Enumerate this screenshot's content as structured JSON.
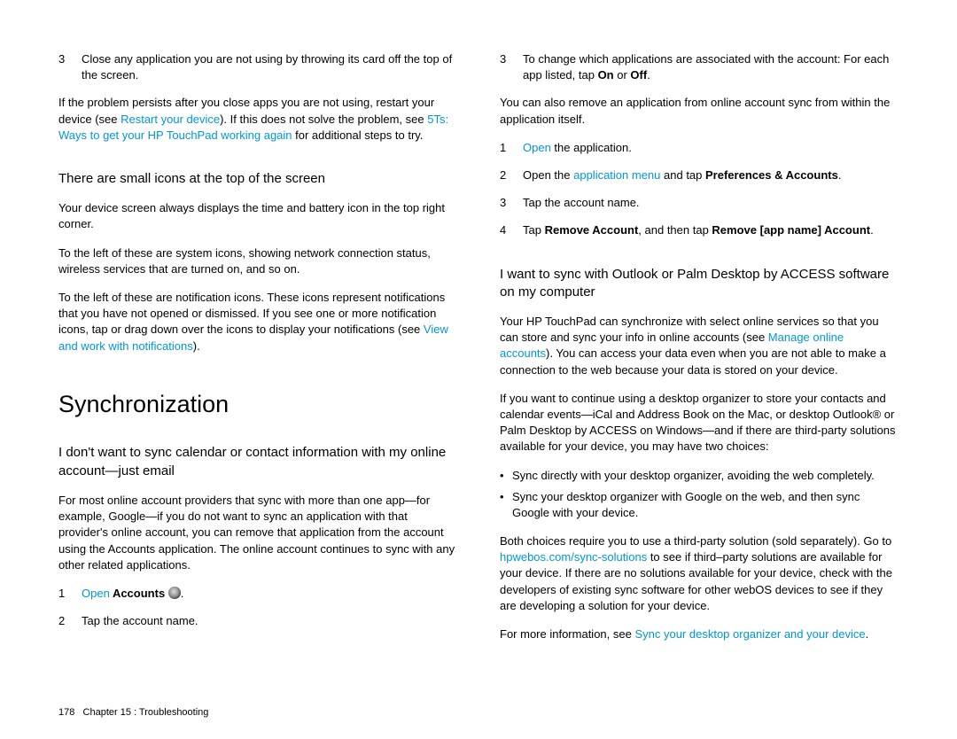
{
  "left": {
    "step3": {
      "n": "3",
      "t": "Close any application you are not using by throwing its card off the top of the screen."
    },
    "persist_a": "If the problem persists after you close apps you are not using, restart your device (see ",
    "persist_link1": "Restart your device",
    "persist_b": "). If this does not solve the problem, see ",
    "persist_link2": "5Ts: Ways to get your HP TouchPad working again",
    "persist_c": " for additional steps to try.",
    "h_icons": "There are small icons at the top of the screen",
    "p_icons1": "Your device screen always displays the time and battery icon in the top right corner.",
    "p_icons2": "To the left of these are system icons, showing network connection status, wireless services that are turned on, and so on.",
    "p_icons3a": "To the left of these are notification icons. These icons represent notifications that you have not opened or dismissed. If you see one or more notification icons, tap or drag down over the icons to display your notifications (see ",
    "p_icons3_link": "View and work with notifications",
    "p_icons3b": ").",
    "h_sync": "Synchronization",
    "h_dontsync": "I don't want to sync calendar or contact information with my online account—just email",
    "p_dontsync": "For most online account providers that sync with more than one app—for example, Google—if you do not want to sync an application with that provider's online account, you can remove that application from the account using the Accounts application. The online account continues to sync with any other related applications.",
    "s1": {
      "n": "1",
      "link": "Open",
      "bold": " Accounts",
      "dot": "."
    },
    "s2": {
      "n": "2",
      "t": "Tap the account name."
    }
  },
  "right": {
    "step3": {
      "n": "3",
      "a": "To change which applications are associated with the account: For each app listed, tap ",
      "b1": "On",
      "mid": " or ",
      "b2": "Off",
      "end": "."
    },
    "p_remove": "You can also remove an application from online account sync from within the application itself.",
    "r1": {
      "n": "1",
      "link": "Open",
      "t": " the application."
    },
    "r2": {
      "n": "2",
      "a": "Open the ",
      "link": "application menu",
      "b": " and tap ",
      "bold": "Preferences & Accounts",
      "end": "."
    },
    "r3": {
      "n": "3",
      "t": "Tap the account name."
    },
    "r4": {
      "n": "4",
      "a": "Tap ",
      "b1": "Remove Account",
      "mid": ", and then tap ",
      "b2": "Remove [app name] Account",
      "end": "."
    },
    "h_outlook": "I want to sync with Outlook or Palm Desktop by ACCESS software on my computer",
    "p_out1a": "Your HP TouchPad can synchronize with select online services so that you can store and sync your info in online accounts (see ",
    "p_out1_link": "Manage online accounts",
    "p_out1b": "). You can access your data even when you are not able to make a connection to the web because your data is stored on your device.",
    "p_out2": "If you want to continue using a desktop organizer to store your contacts and calendar events—iCal and Address Book on the Mac, or desktop Outlook® or Palm Desktop by ACCESS on Windows—and if there are third-party solutions available for your device, you may have two choices:",
    "bul1": "Sync directly with your desktop organizer, avoiding the web completely.",
    "bul2": "Sync your desktop organizer with Google on the web, and then sync Google with your device.",
    "p_both_a": "Both choices require you to use a third-party solution (sold separately). Go to ",
    "p_both_link": "hpwebos.com/sync-solutions",
    "p_both_b": " to see if third–party solutions are available for your device. If there are no solutions available for your device, check with the developers of existing sync software for other webOS devices to see if they are developing a solution for your device.",
    "p_more_a": "For more information, see ",
    "p_more_link": "Sync your desktop organizer and your device",
    "p_more_b": "."
  },
  "footer": {
    "page": "178",
    "chapter": "Chapter 15 : Troubleshooting"
  }
}
